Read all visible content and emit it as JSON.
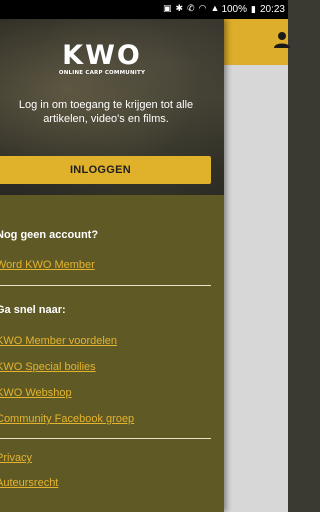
{
  "status_bar": {
    "battery": "100%",
    "time": "20:23"
  },
  "header": {
    "logo_main": "KWO",
    "logo_sub": "ONLINE CARP COMMUNITY",
    "login_prompt": "Log in om toegang te krijgen tot alle artikelen, video's en films.",
    "login_button": "INLOGGEN"
  },
  "drawer": {
    "no_account_heading": "Nog geen account?",
    "become_member_link": "Word KWO Member",
    "quick_nav_heading": "Ga snel naar:",
    "quick_links": [
      "KWO Member voordelen",
      "KWO Special boilies",
      "KWO Webshop",
      "Community Facebook groep"
    ],
    "footer_links": [
      "Privacy",
      "Auteursrecht"
    ]
  },
  "colors": {
    "accent": "#e0b12b",
    "drawer_bg": "#5e5925",
    "toolbar": "#dcae2b"
  },
  "icons": {
    "account": "person-icon"
  }
}
